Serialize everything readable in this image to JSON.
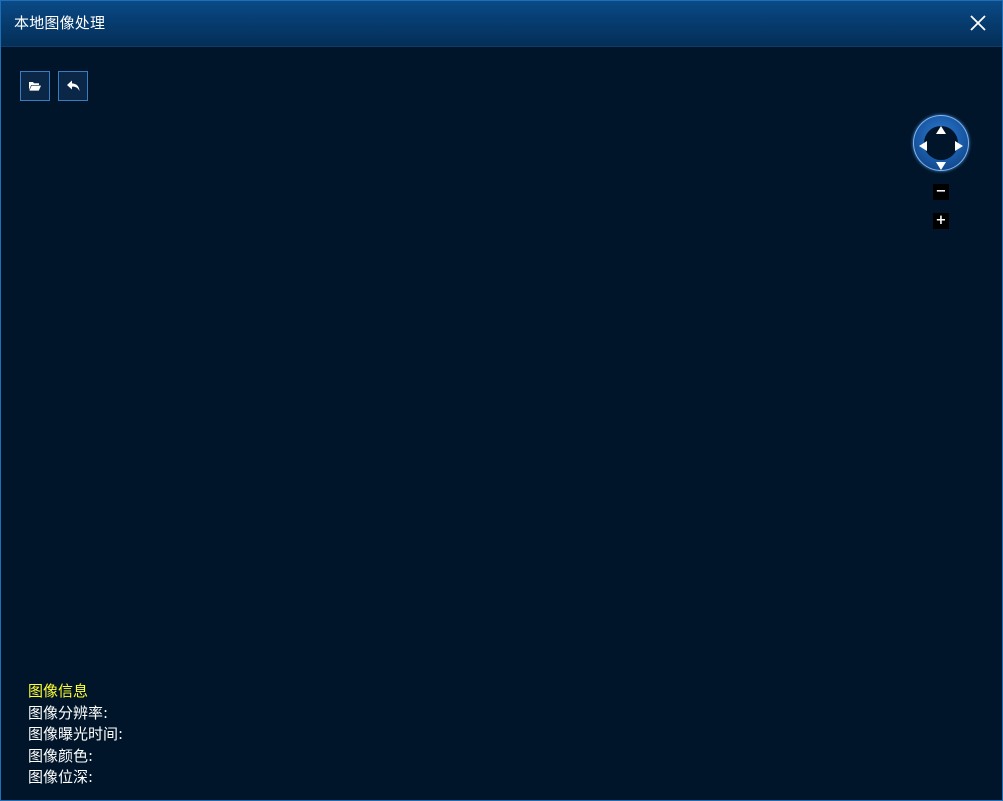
{
  "window": {
    "title": "本地图像处理"
  },
  "toolbar": {
    "open_icon": "folder-open-icon",
    "undo_icon": "undo-icon"
  },
  "ptz": {
    "zoom_out_label": "−",
    "zoom_in_label": "+"
  },
  "image_info": {
    "title": "图像信息",
    "resolution_label": "图像分辨率:",
    "exposure_label": "图像曝光时间:",
    "color_label": "图像颜色:",
    "bit_depth_label": "图像位深:"
  },
  "colors": {
    "background": "#001529",
    "titlebar": "#063a6c",
    "info_title": "#ffff33",
    "ptz_ring": "#1857a3"
  }
}
